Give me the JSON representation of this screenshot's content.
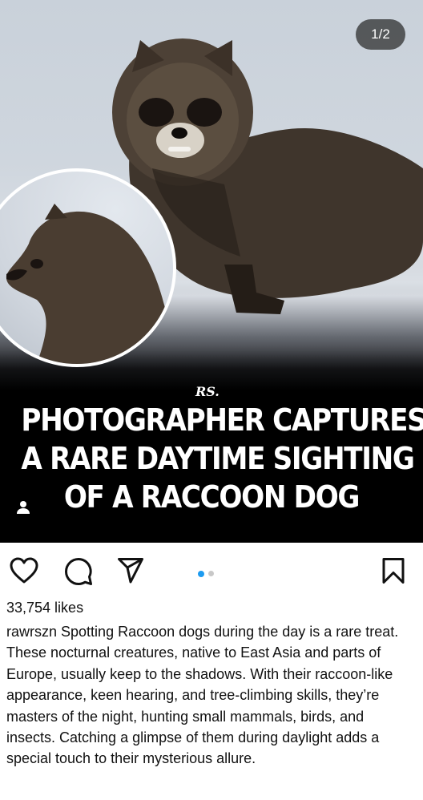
{
  "media": {
    "counter": "1/2",
    "brand_logo": "RS.",
    "headline_lines": [
      "PHOTOGRAPHER CAPTURES",
      "A RARE DAYTIME SIGHTING",
      "OF A RACCOON DOG"
    ],
    "carousel": {
      "total": 2,
      "active": 1
    }
  },
  "actions": {
    "icons": [
      "heart-icon",
      "comment-icon",
      "share-icon",
      "bookmark-icon"
    ]
  },
  "post": {
    "likes": "33,754 likes",
    "username": "rawrszn",
    "caption": "Spotting Raccoon dogs during the day is a rare treat. These nocturnal creatures, native to East Asia and parts of Europe, usually keep to the shadows. With their raccoon-like appearance, keen hearing, and tree-climbing skills, they’re masters of the night, hunting small mammals, birds, and insects. Catching a glimpse of them during daylight adds a special touch to their mysterious allure."
  },
  "colors": {
    "carousel_active": "#1d9bf0",
    "carousel_inactive": "#c8c8c8",
    "headline_bg": "#000000"
  }
}
